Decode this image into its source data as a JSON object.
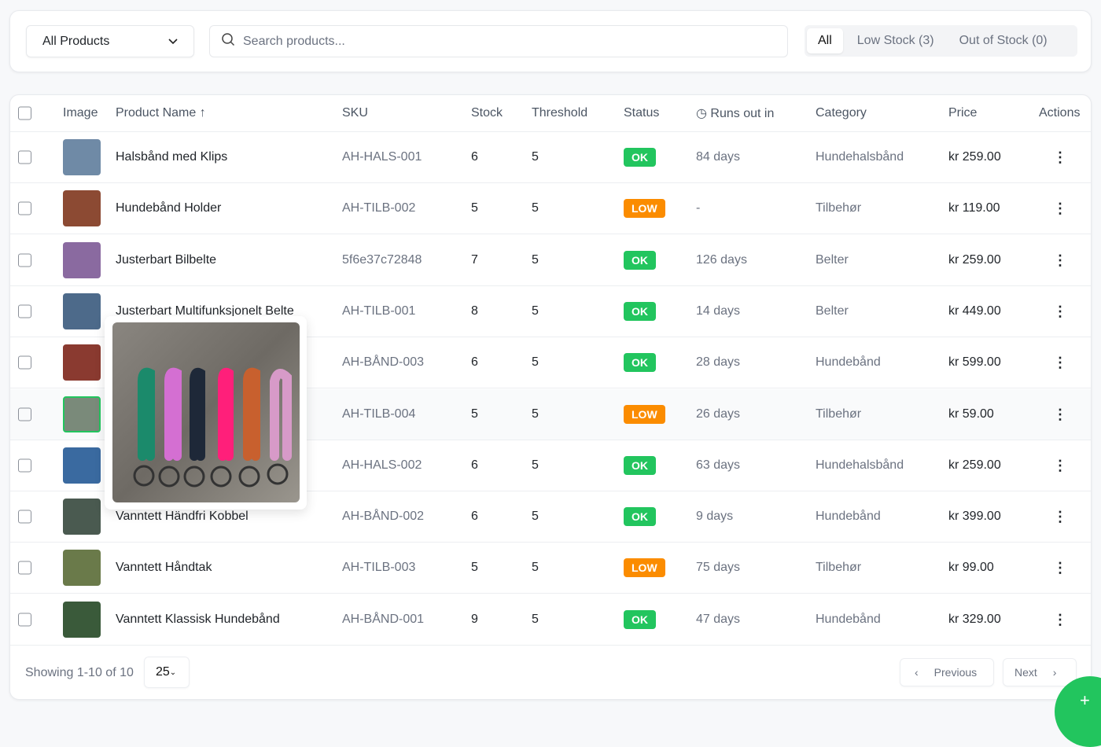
{
  "filters": {
    "category_select": "All Products",
    "search_placeholder": "Search products...",
    "tabs": [
      "All",
      "Low Stock (3)",
      "Out of Stock (0)"
    ],
    "active_tab": "All"
  },
  "table": {
    "headers": {
      "image": "Image",
      "name": "Product Name ↑",
      "sku": "SKU",
      "stock": "Stock",
      "threshold": "Threshold",
      "status": "Status",
      "runs_out": "Runs out in",
      "category": "Category",
      "price": "Price",
      "actions": "Actions"
    },
    "rows": [
      {
        "name": "Halsbånd med Klips",
        "sku": "AH-HALS-001",
        "stock": "6",
        "threshold": "5",
        "status": "OK",
        "runs_out": "84 days",
        "category": "Hundehalsbånd",
        "price": "kr 259.00"
      },
      {
        "name": "Hundebånd Holder",
        "sku": "AH-TILB-002",
        "stock": "5",
        "threshold": "5",
        "status": "LOW",
        "runs_out": "-",
        "category": "Tilbehør",
        "price": "kr 119.00"
      },
      {
        "name": "Justerbart Bilbelte",
        "sku": "5f6e37c72848",
        "stock": "7",
        "threshold": "5",
        "status": "OK",
        "runs_out": "126 days",
        "category": "Belter",
        "price": "kr 259.00"
      },
      {
        "name": "Justerbart Multifunksjonelt Belte",
        "sku": "AH-TILB-001",
        "stock": "8",
        "threshold": "5",
        "status": "OK",
        "runs_out": "14 days",
        "category": "Belter",
        "price": "kr 449.00"
      },
      {
        "name": "",
        "sku": "AH-BÅND-003",
        "stock": "6",
        "threshold": "5",
        "status": "OK",
        "runs_out": "28 days",
        "category": "Hundebånd",
        "price": "kr 599.00"
      },
      {
        "name": "",
        "sku": "AH-TILB-004",
        "stock": "5",
        "threshold": "5",
        "status": "LOW",
        "runs_out": "26 days",
        "category": "Tilbehør",
        "price": "kr 59.00"
      },
      {
        "name": "",
        "sku": "AH-HALS-002",
        "stock": "6",
        "threshold": "5",
        "status": "OK",
        "runs_out": "63 days",
        "category": "Hundehalsbånd",
        "price": "kr 259.00"
      },
      {
        "name": "Vanntett Händfri Kobbel",
        "sku": "AH-BÅND-002",
        "stock": "6",
        "threshold": "5",
        "status": "OK",
        "runs_out": "9 days",
        "category": "Hundebånd",
        "price": "kr 399.00"
      },
      {
        "name": "Vanntett Håndtak",
        "sku": "AH-TILB-003",
        "stock": "5",
        "threshold": "5",
        "status": "LOW",
        "runs_out": "75 days",
        "category": "Tilbehør",
        "price": "kr 99.00"
      },
      {
        "name": "Vanntett Klassisk Hundebånd",
        "sku": "AH-BÅND-001",
        "stock": "9",
        "threshold": "5",
        "status": "OK",
        "runs_out": "47 days",
        "category": "Hundebånd",
        "price": "kr 329.00"
      }
    ]
  },
  "footer": {
    "showing": "Showing 1-10 of 10",
    "page_size": "25",
    "previous": "Previous",
    "next": "Next"
  },
  "colors": {
    "ok": "#22c55e",
    "low": "#fb8c00",
    "fab": "#22c55e"
  },
  "fab_icon": "plus-icon"
}
